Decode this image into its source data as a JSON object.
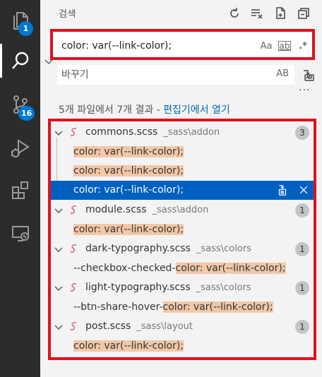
{
  "activity": {
    "explorer_badge": "1",
    "scm_badge": "16"
  },
  "header": {
    "title": "검색"
  },
  "search": {
    "value": "color: var(--link-color);",
    "match_case": "Aa",
    "whole_word": "ab",
    "regex": ".*"
  },
  "replace": {
    "placeholder": "바꾸기",
    "preserve_case": "AB"
  },
  "more": "···",
  "summary": {
    "text": "5개 파일에서 7개 결과 - ",
    "link": "편집기에서 열기"
  },
  "files": [
    {
      "name": "commons.scss",
      "path": "_sass\\addon",
      "count": "3",
      "matches": [
        {
          "before": "",
          "match": "color: var(--link-color);",
          "selected": false
        },
        {
          "before": "",
          "match": "color: var(--link-color);",
          "selected": false
        },
        {
          "before": "",
          "match": "color: var(--link-color);",
          "selected": true
        }
      ]
    },
    {
      "name": "module.scss",
      "path": "_sass\\addon",
      "count": "1",
      "matches": [
        {
          "before": "",
          "match": "color: var(--link-color);",
          "selected": false
        }
      ]
    },
    {
      "name": "dark-typography.scss",
      "path": "_sass\\colors",
      "count": "1",
      "matches": [
        {
          "before": "--checkbox-checked-",
          "match": "color: var(--link-color);",
          "selected": false
        }
      ]
    },
    {
      "name": "light-typography.scss",
      "path": "_sass\\colors",
      "count": "1",
      "matches": [
        {
          "before": "--btn-share-hover-",
          "match": "color: var(--link-color);",
          "selected": false
        }
      ]
    },
    {
      "name": "post.scss",
      "path": "_sass\\layout",
      "count": "1",
      "matches": [
        {
          "before": "",
          "match": "color: var(--link-color);",
          "selected": false
        }
      ]
    }
  ],
  "colors": {
    "accent": "#0078d4",
    "selection": "#0060c0",
    "highlight": "#f2c8a8",
    "annotation_red": "#e0101e",
    "sass_icon": "#d05a7a"
  },
  "icons": {
    "explorer": "files-icon",
    "search": "search-icon",
    "scm": "source-control-icon",
    "debug": "run-debug-icon",
    "extensions": "extensions-icon",
    "remote": "remote-explorer-icon",
    "refresh": "refresh-icon",
    "clear": "clear-results-icon",
    "new_search": "new-search-editor-icon",
    "collapse": "collapse-all-icon",
    "replace_all": "replace-all-icon",
    "replace_one": "replace-icon",
    "dismiss": "close-icon",
    "file": "sass-file-icon"
  }
}
